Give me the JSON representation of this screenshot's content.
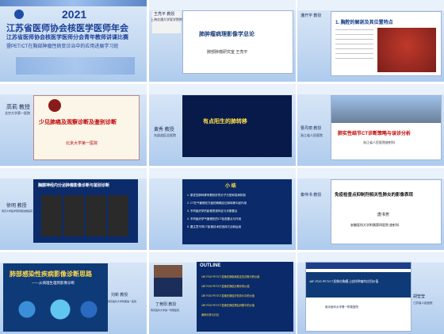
{
  "tiles": [
    {
      "id": "tile-1",
      "year": "2021",
      "title_line1": "江苏省医师协会核医学医师年会",
      "title_line2": "江苏省医师协会核医学医师分会青年教师讲课比赛",
      "title_line3": "暨PET/CT在胸部肿瘤性病变诊治中的应用进展学习班"
    },
    {
      "id": "tile-2",
      "speaker": "王亮平 教授",
      "affiliation": "上海交通大学医学院附属",
      "slide_title": "肺肿瘤病理影像学总论",
      "slide_sub": "肺部肿瘤研究室   王亮平"
    },
    {
      "id": "tile-3",
      "speaker": "潘开宇 教授",
      "slide_title": "1. 胸腔的解剖及其位置特点"
    },
    {
      "id": "tile-4",
      "speaker": "高莉 教授",
      "affiliation": "北京大学第一医院",
      "slide_title": "少见肺癌及观察诊断及鉴别诊断",
      "slide_sub": "北京大学第一医院"
    },
    {
      "id": "tile-5",
      "speaker": "黄秀 教授",
      "affiliation": "东部战区总医院",
      "slide_title": "有点阳生的肺转移"
    },
    {
      "id": "tile-6",
      "speaker": "曹丹丽 教授",
      "affiliation": "浙江省人民医院",
      "slide_title": "肺实性结节CT诊断策略与误诊分析",
      "slide_sub": "浙江省人民医院放射科"
    },
    {
      "id": "tile-7",
      "speaker": "徐明 教授",
      "affiliation": "南京大学医学院附属鼓楼医院",
      "slide_title": "胸腺神经内分泌肿瘤影像诊断与鉴别诊断"
    },
    {
      "id": "tile-8",
      "slide_title": "小   结",
      "bullets": [
        "1. 原发性肺转移有着较好的分子分型和发病机制",
        "2. CT在气管侵犯方面的精确定位和转移中起作用",
        "3. 不同组织学的影像表现特征与诊断要点",
        "4. 不同组织学气管侵犯的CT检查要点与作用",
        "5. 要注意不同CT影像技术的选择方法和运用"
      ]
    },
    {
      "id": "tile-9",
      "speaker": "秦伟书 教授",
      "slide_title": "免疫检查点抑制剂相关性肺炎的影像表现",
      "author": "唐书芳",
      "slide_sub": "安徽医科大学附属第四医院 放射科"
    },
    {
      "id": "tile-10",
      "speaker": "刘新 教授",
      "affiliation": "南京医科大学附属第一医院",
      "slide_title": "肺部感染性疾病影像诊断思路",
      "slide_sub": "——从病理生理到影像诊断"
    },
    {
      "id": "tile-11",
      "speaker": "丁黄阳 教授",
      "affiliation": "南京医科大学第一附属医院",
      "slide_title": "OUTLINE",
      "bullets": [
        "18F-FDG PET/CT显像在肺部病变定性诊断中的价值",
        "18F-FDG PET/CT显像在肺癌分期中的价值",
        "18F-FDG PET/CT显像在肺癌疗效评价中的价值",
        "18F-FDG PET/CT显像在肺癌预后判断中的价值",
        "病例分析与讨论"
      ]
    },
    {
      "id": "tile-12",
      "speaker": "胡莹莹",
      "affiliation": "江苏省人民医院",
      "slide_title": "18F-FDG PET/CT显像在胸膜上皮样肿瘤的应用价值",
      "slide_sub": "南京医科大学第一附属医院"
    }
  ]
}
